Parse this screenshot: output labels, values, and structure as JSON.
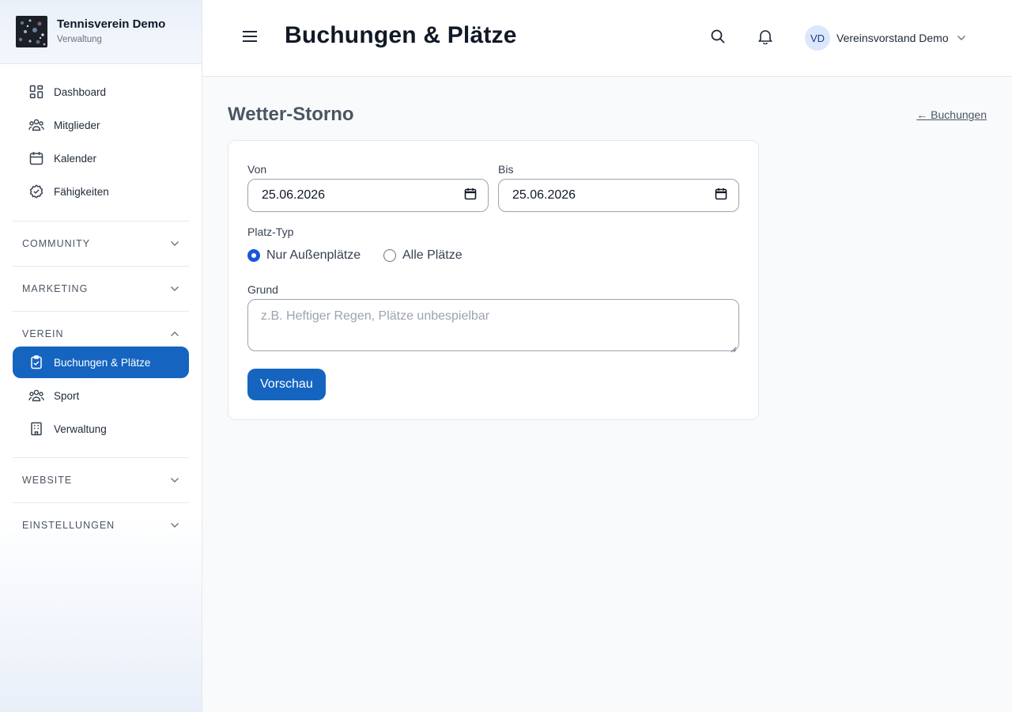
{
  "brand": {
    "title": "Tennisverein Demo",
    "subtitle": "Verwaltung"
  },
  "nav": {
    "items": [
      {
        "label": "Dashboard",
        "icon": "dashboard-icon"
      },
      {
        "label": "Mitglieder",
        "icon": "users-icon"
      },
      {
        "label": "Kalender",
        "icon": "calendar-icon"
      },
      {
        "label": "Fähigkeiten",
        "icon": "badge-check-icon"
      }
    ],
    "sections": {
      "community": "COMMUNITY",
      "marketing": "MARKETING",
      "verein": "VEREIN",
      "website": "WEBSITE",
      "einstellungen": "EINSTELLUNGEN"
    },
    "verein_items": [
      {
        "label": "Buchungen & Plätze",
        "icon": "clipboard-check-icon",
        "active": true
      },
      {
        "label": "Sport",
        "icon": "users-icon"
      },
      {
        "label": "Verwaltung",
        "icon": "building-icon"
      }
    ]
  },
  "header": {
    "title": "Buchungen & Plätze",
    "user": {
      "initials": "VD",
      "name": "Vereinsvorstand Demo"
    }
  },
  "main": {
    "title": "Wetter-Storno",
    "back_link": "← Buchungen",
    "form": {
      "from_label": "Von",
      "from_value": "25.06.2026",
      "to_label": "Bis",
      "to_value": "25.06.2026",
      "court_type_label": "Platz-Typ",
      "court_options": [
        {
          "label": "Nur Außenplätze",
          "selected": true
        },
        {
          "label": "Alle Plätze",
          "selected": false
        }
      ],
      "reason_label": "Grund",
      "reason_placeholder": "z.B. Heftiger Regen, Plätze unbespielbar",
      "submit_label": "Vorschau"
    }
  },
  "colors": {
    "accent": "#1565c0",
    "radio": "#1a56db",
    "avatar_bg": "#dbe7fb"
  }
}
